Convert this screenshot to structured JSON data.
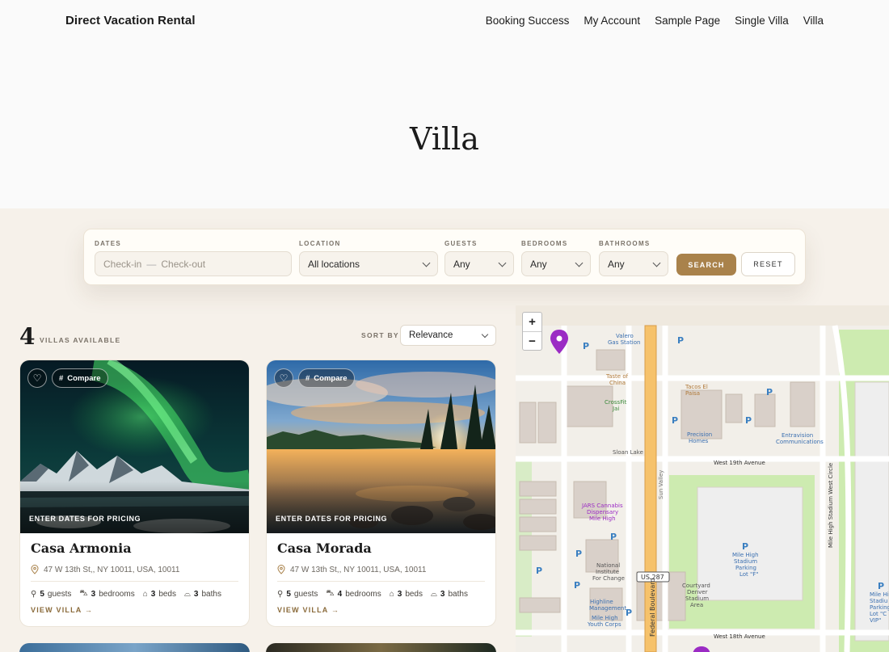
{
  "site": {
    "brand": "Direct Vacation Rental",
    "nav": [
      "Booking Success",
      "My Account",
      "Sample Page",
      "Single Villa",
      "Villa"
    ]
  },
  "page": {
    "title": "Villa"
  },
  "search": {
    "dates": {
      "label": "DATES",
      "checkin": "Check-in",
      "separator": "—",
      "checkout": "Check-out"
    },
    "location": {
      "label": "LOCATION",
      "value": "All locations"
    },
    "guests": {
      "label": "GUESTS",
      "value": "Any"
    },
    "bedrooms": {
      "label": "BEDROOMS",
      "value": "Any"
    },
    "bathrooms": {
      "label": "BATHROOMS",
      "value": "Any"
    },
    "search_button": "SEARCH",
    "reset_button": "RESET"
  },
  "results": {
    "count": "4",
    "count_label": "VILLAS AVAILABLE",
    "sort_label": "SORT BY",
    "sort_value": "Relevance"
  },
  "cards": [
    {
      "compare": "Compare",
      "price_hint": "ENTER DATES FOR PRICING",
      "name": "Casa Armonia",
      "address": "47 W 13th St,, NY 10011, USA, 10011",
      "guests": "5",
      "guests_label": "guests",
      "bedrooms": "3",
      "bedrooms_label": "bedrooms",
      "beds": "3",
      "beds_label": "beds",
      "baths": "3",
      "baths_label": "baths",
      "view": "VIEW VILLA"
    },
    {
      "compare": "Compare",
      "price_hint": "ENTER DATES FOR PRICING",
      "name": "Casa Morada",
      "address": "47 W 13th St,, NY 10011, USA, 10011",
      "guests": "5",
      "guests_label": "guests",
      "bedrooms": "4",
      "bedrooms_label": "bedrooms",
      "beds": "3",
      "beds_label": "beds",
      "baths": "3",
      "baths_label": "baths",
      "view": "VIEW VILLA"
    }
  ],
  "map": {
    "zoom_in": "+",
    "zoom_out": "−",
    "labels": {
      "valero": "Valero Gas Station",
      "taste": "Taste of China",
      "crossfit": "CrossFit Jai",
      "tacos": "Tacos El Paisa",
      "precision": "Precision Homes",
      "entravision": "Entravision Communications",
      "sloan": "Sloan Lake",
      "w19": "West 19th Avenue",
      "w18": "West 18th Avenue",
      "jars": "JARS Cannabis Dispensary Mile High",
      "nifc": "National Institute For Change",
      "highline": "Highline Management",
      "mhyc": "Mile High Youth Corps",
      "courtyard": "Courtyard Denver Stadium Area",
      "parking_f": "Mile High Stadium Parking Lot \"F\"",
      "us287": "US 287",
      "federal": "Federal Boulevard",
      "sunvalley": "Sun Valley",
      "stadium_circle": "Mile High Stadium West Circle",
      "edge_label": "Mile High Stadiu Parking Lot \"C VIP\""
    }
  },
  "colors": {
    "accent": "#a9824b",
    "pin": "#9b2bc4",
    "background": "#f6f1ea"
  }
}
